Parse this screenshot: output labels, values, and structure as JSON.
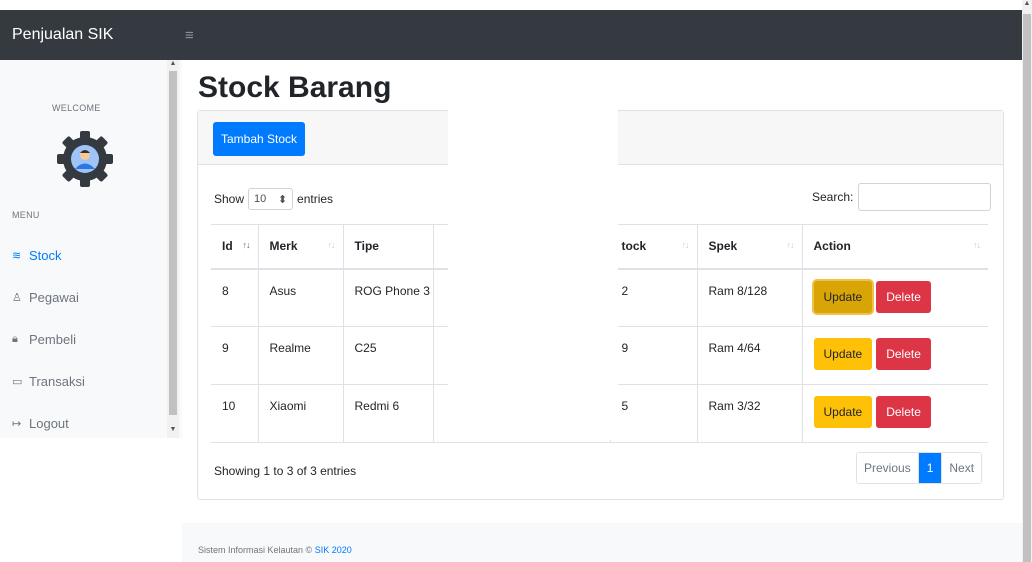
{
  "navbar": {
    "brand": "Penjualan SIK",
    "toggle_glyph": "≡"
  },
  "sidebar": {
    "welcome": "WELCOME",
    "avatar_icon": "gear-user-icon",
    "menu_title": "MENU",
    "items": [
      {
        "label": "Stock",
        "icon": "layers-icon",
        "glyph": "≋",
        "active": true
      },
      {
        "label": "Pegawai",
        "icon": "user-icon",
        "glyph": "♙",
        "active": false
      },
      {
        "label": "Pembeli",
        "icon": "lock-icon",
        "glyph": "🔒︎",
        "active": false
      },
      {
        "label": "Transaksi",
        "icon": "money-icon",
        "glyph": "▭",
        "active": false
      },
      {
        "label": "Logout",
        "icon": "sign-out-icon",
        "glyph": "↦",
        "active": false
      }
    ]
  },
  "main": {
    "title": "Stock Barang",
    "add_button": "Tambah Stock",
    "length": {
      "prefix": "Show",
      "value": "10",
      "suffix": "entries"
    },
    "search_label": "Search:",
    "search_value": "",
    "table": {
      "columns": [
        "Id",
        "Merk",
        "Tipe",
        "",
        "Stock",
        "Spek",
        "Action"
      ],
      "visible_stock_header": "tock",
      "rows": [
        {
          "id": "8",
          "merk": "Asus",
          "tipe": "ROG Phone 3",
          "stock": "2",
          "spek": "Ram 8/128"
        },
        {
          "id": "9",
          "merk": "Realme",
          "tipe": "C25",
          "stock": "9",
          "spek": "Ram 4/64"
        },
        {
          "id": "10",
          "merk": "Xiaomi",
          "tipe": "Redmi 6",
          "stock": "5",
          "spek": "Ram 3/32"
        }
      ],
      "update_label": "Update",
      "delete_label": "Delete"
    },
    "info": "Showing 1 to 3 of 3 entries",
    "pagination": {
      "previous": "Previous",
      "current": "1",
      "next": "Next"
    }
  },
  "footer": {
    "text": "Sistem Informasi Kelautan ©",
    "link": "SIK 2020"
  },
  "colors": {
    "navbar": "#343a40",
    "primary": "#007bff",
    "warning": "#ffc107",
    "danger": "#dc3545"
  }
}
